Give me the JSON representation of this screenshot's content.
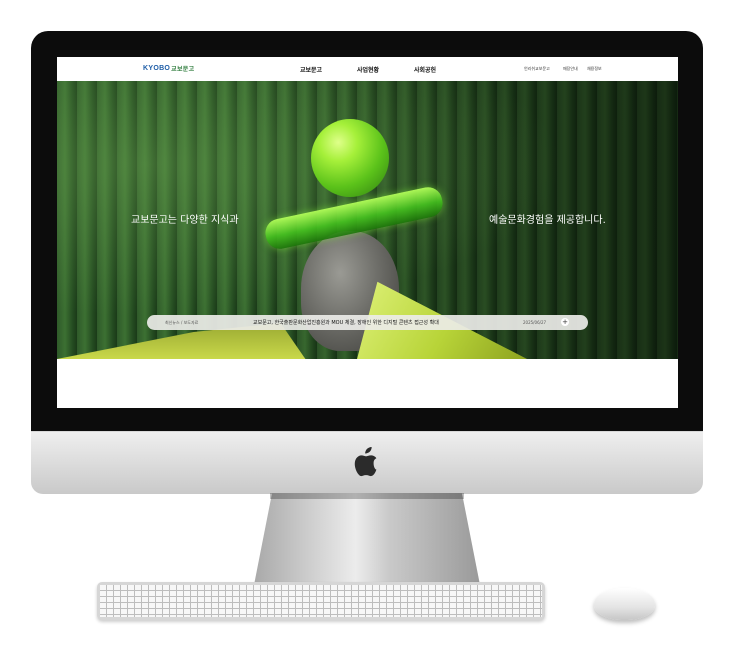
{
  "site": {
    "logo_text": "KYOBO",
    "logo_sub": "교보문고",
    "nav": [
      "교보문고",
      "사업현황",
      "사회공헌"
    ],
    "utility": [
      "언리쉬교보문고",
      "매장안내",
      "채용정보"
    ]
  },
  "hero": {
    "text_left": "교보문고는 다양한 지식과",
    "text_right": "예술문화경험을 제공합니다."
  },
  "news": {
    "label": "최신뉴스 / 보도자료",
    "title": "교보문고, 한국출판문화산업진흥원과 MOU 체결, 장애인 위한 디지털 콘텐츠 접근성 확대",
    "date": "2025/06/27",
    "more": "+"
  },
  "colors": {
    "accent_green": "#5bc21a",
    "brand_blue": "#1f5ea8"
  }
}
